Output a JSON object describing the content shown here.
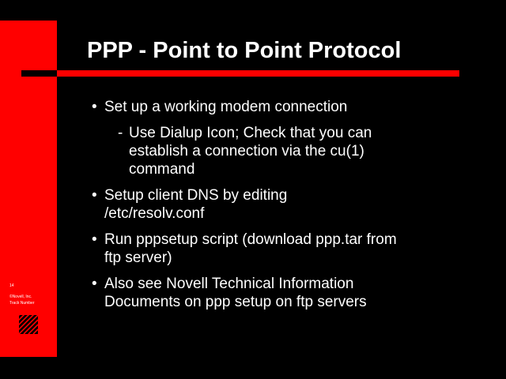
{
  "slide": {
    "title": "PPP - Point to Point Protocol",
    "sidebar_page": "14",
    "sidebar_copyright": "©Novell, Inc.",
    "sidebar_trademark": "Track Number",
    "logo_icon": "novell-logo-icon",
    "accent_color": "#ff0000",
    "background_color": "#000000"
  },
  "bullets": [
    {
      "mark": "•",
      "text": "Set up a working modem connection",
      "sub": [
        {
          "mark": "-",
          "text": "Use Dialup Icon; Check that you can establish a connection via the cu(1) command"
        }
      ]
    },
    {
      "mark": "•",
      "text": "Setup client DNS by editing /etc/resolv.conf"
    },
    {
      "mark": "•",
      "text": "Run pppsetup script (download ppp.tar from ftp server)"
    },
    {
      "mark": "•",
      "text": "Also see Novell Technical Information Documents on ppp setup on ftp servers"
    }
  ]
}
